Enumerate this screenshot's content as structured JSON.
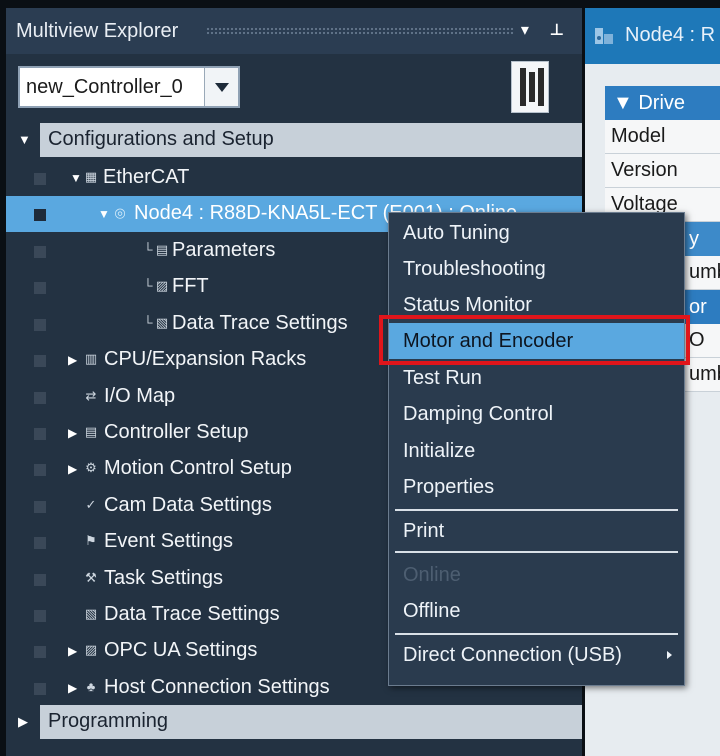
{
  "explorer": {
    "title": "Multiview Explorer",
    "pin_buttons": "▾ ⊥",
    "controller_select": "new_Controller_0",
    "config_header": "Configurations and Setup",
    "programming_header": "Programming",
    "tree": [
      {
        "label": "EtherCAT",
        "icon": "ethercat-icon",
        "glyph": "▦"
      },
      {
        "label": "Node4 : R88D-KNA5L-ECT (E001) : Online",
        "icon": "node-icon",
        "glyph": "◎"
      },
      {
        "label": "Parameters",
        "icon": "parameters-icon",
        "glyph": "▤"
      },
      {
        "label": "FFT",
        "icon": "fft-icon",
        "glyph": "▨"
      },
      {
        "label": "Data Trace Settings",
        "icon": "data-trace-icon",
        "glyph": "▧"
      },
      {
        "label": "CPU/Expansion Racks",
        "icon": "racks-icon",
        "glyph": "▥"
      },
      {
        "label": "I/O Map",
        "icon": "io-map-icon",
        "glyph": "⇄"
      },
      {
        "label": "Controller Setup",
        "icon": "controller-setup-icon",
        "glyph": "▤"
      },
      {
        "label": "Motion Control Setup",
        "icon": "motion-icon",
        "glyph": "⚙"
      },
      {
        "label": "Cam Data Settings",
        "icon": "cam-icon",
        "glyph": "✓"
      },
      {
        "label": "Event Settings",
        "icon": "event-icon",
        "glyph": "⚑"
      },
      {
        "label": "Task Settings",
        "icon": "task-icon",
        "glyph": "⚒"
      },
      {
        "label": "Data Trace Settings",
        "icon": "data-trace-icon",
        "glyph": "▧"
      },
      {
        "label": "OPC UA Settings",
        "icon": "opcua-icon",
        "glyph": "▨"
      },
      {
        "label": "Host Connection Settings",
        "icon": "host-icon",
        "glyph": "♣"
      }
    ]
  },
  "editor": {
    "tab_title": "Node4 : R",
    "section_drive": "▼ Drive",
    "rows": [
      "Model",
      "Version",
      "Voltage"
    ],
    "partial": [
      "y",
      "umb",
      "or",
      "O",
      "umb"
    ]
  },
  "context_menu": {
    "items": [
      {
        "label": "Auto Tuning"
      },
      {
        "label": "Troubleshooting"
      },
      {
        "label": "Status Monitor"
      },
      {
        "label": "Motor and Encoder"
      },
      {
        "label": "Test Run"
      },
      {
        "label": "Damping Control"
      },
      {
        "label": "Initialize"
      },
      {
        "label": "Properties"
      },
      {
        "label": "Print"
      },
      {
        "label": "Online"
      },
      {
        "label": "Offline"
      },
      {
        "label": "Direct Connection (USB)"
      }
    ]
  },
  "colors": {
    "highlight_blue": "#5aa8e0",
    "annotation_red": "#e0151b",
    "panel_bg": "#233242"
  }
}
